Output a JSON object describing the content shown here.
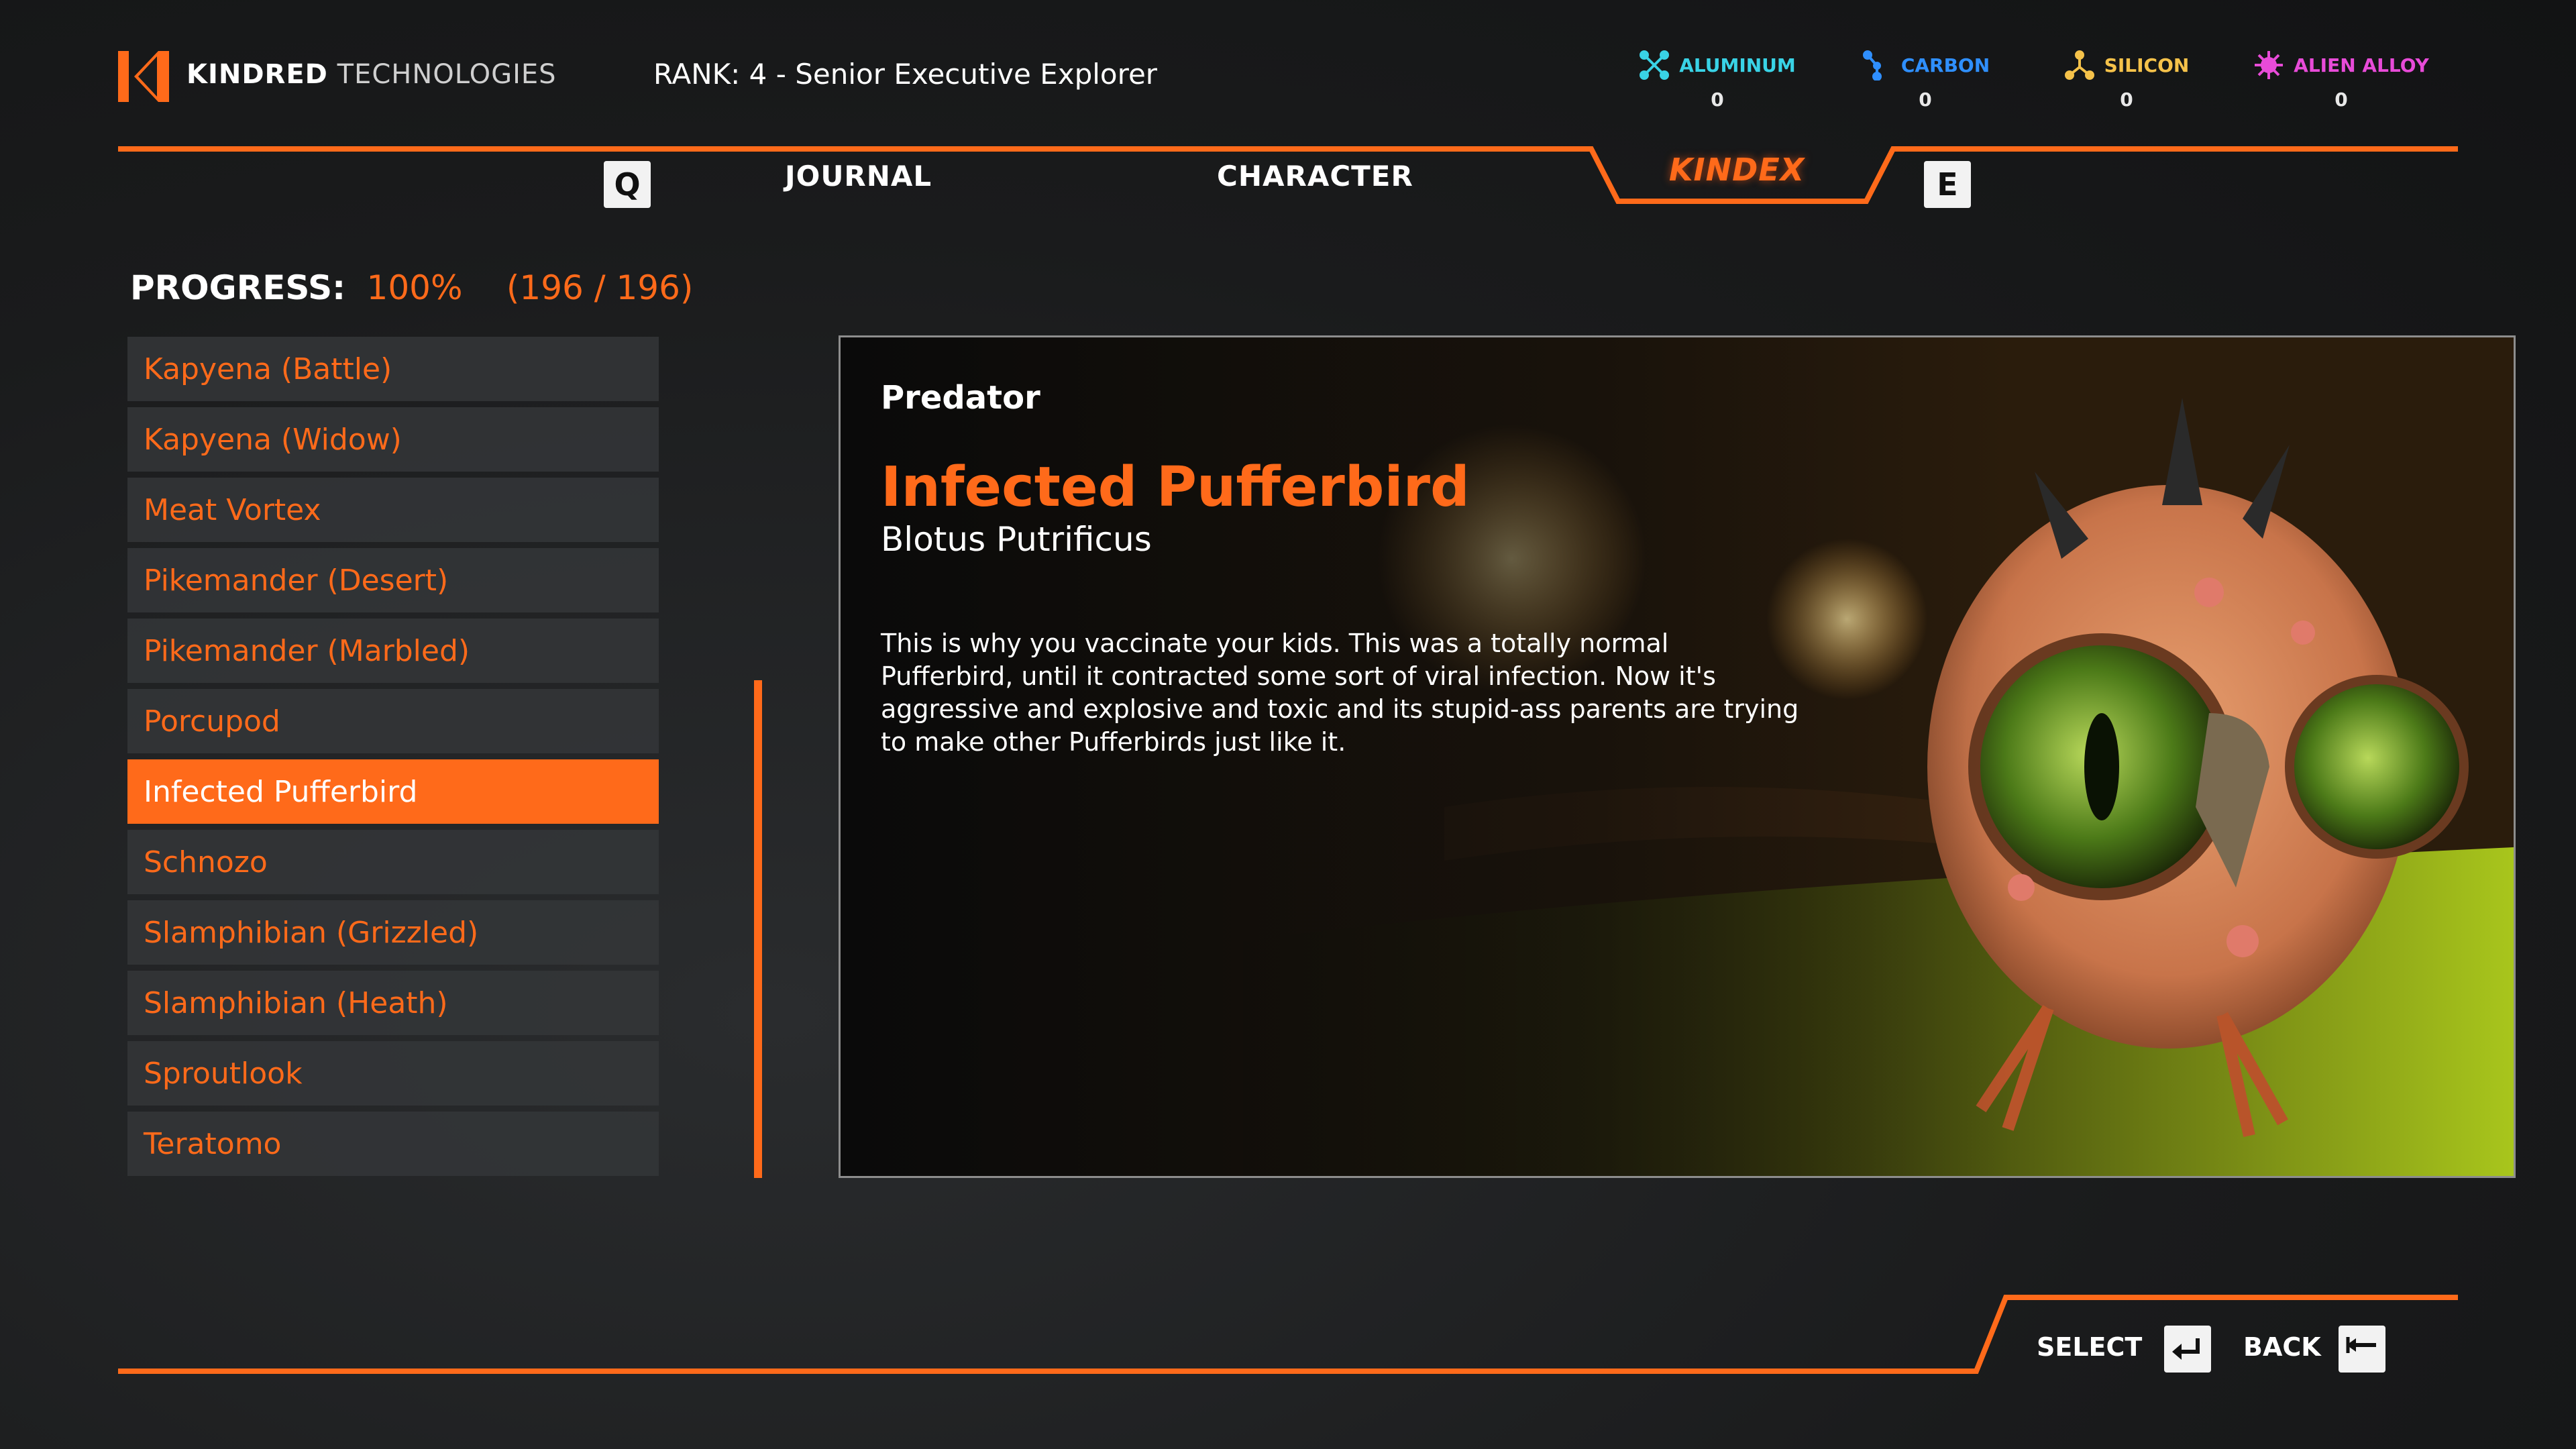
{
  "header": {
    "brand_primary": "KINDRED",
    "brand_secondary": "TECHNOLOGIES",
    "rank": "RANK: 4 - Senior Executive Explorer",
    "resources": [
      {
        "name": "ALUMINUM",
        "value": "0",
        "color": "#39d3e6",
        "icon": "aluminum-icon"
      },
      {
        "name": "CARBON",
        "value": "0",
        "color": "#2f8fff",
        "icon": "carbon-icon"
      },
      {
        "name": "SILICON",
        "value": "0",
        "color": "#f5c24a",
        "icon": "silicon-icon"
      },
      {
        "name": "ALIEN ALLOY",
        "value": "0",
        "color": "#e84bd8",
        "icon": "alien-alloy-icon"
      }
    ]
  },
  "tabs": {
    "prev_key": "Q",
    "next_key": "E",
    "items": [
      "JOURNAL",
      "CHARACTER",
      "KINDEX"
    ],
    "active": "KINDEX"
  },
  "progress": {
    "label": "PROGRESS:",
    "percent": "100%",
    "count": "(196 / 196)"
  },
  "list": {
    "items": [
      "Kapyena (Battle)",
      "Kapyena (Widow)",
      "Meat Vortex",
      "Pikemander (Desert)",
      "Pikemander (Marbled)",
      "Porcupod",
      "Infected Pufferbird",
      "Schnozo",
      "Slamphibian (Grizzled)",
      "Slamphibian (Heath)",
      "Sproutlook",
      "Teratomo"
    ],
    "selected_index": 6
  },
  "detail": {
    "category": "Predator",
    "name": "Infected Pufferbird",
    "scientific_name": "Blotus Putrificus",
    "description": "This is why you vaccinate your kids. This was a totally normal Pufferbird, until it contracted some sort of viral infection. Now it's aggressive and explosive and toxic and its stupid-ass parents are trying to  make other Pufferbirds just like it."
  },
  "footer": {
    "select_label": "SELECT",
    "back_label": "BACK"
  },
  "colors": {
    "accent": "#ff6a1a",
    "list_bg": "#343638",
    "background": "#1a1b1c"
  }
}
